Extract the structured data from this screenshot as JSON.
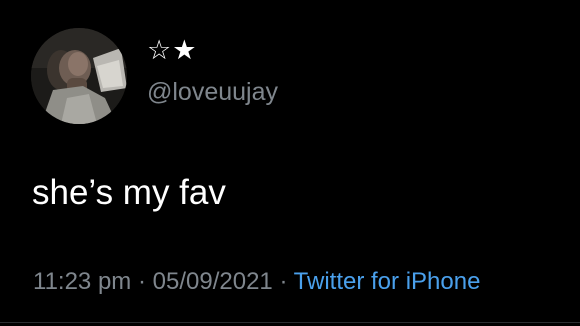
{
  "tweet": {
    "display_name": "☆★",
    "handle": "@loveuujay",
    "text": "she’s my fav",
    "time": "11:23 pm",
    "separator": "·",
    "date": "05/09/2021",
    "source": "Twitter for iPhone"
  },
  "colors": {
    "background": "#000000",
    "text": "#ffffff",
    "secondary_text": "#7f868d",
    "link": "#4aa0ec"
  },
  "icons": {
    "avatar": "profile-photo"
  }
}
